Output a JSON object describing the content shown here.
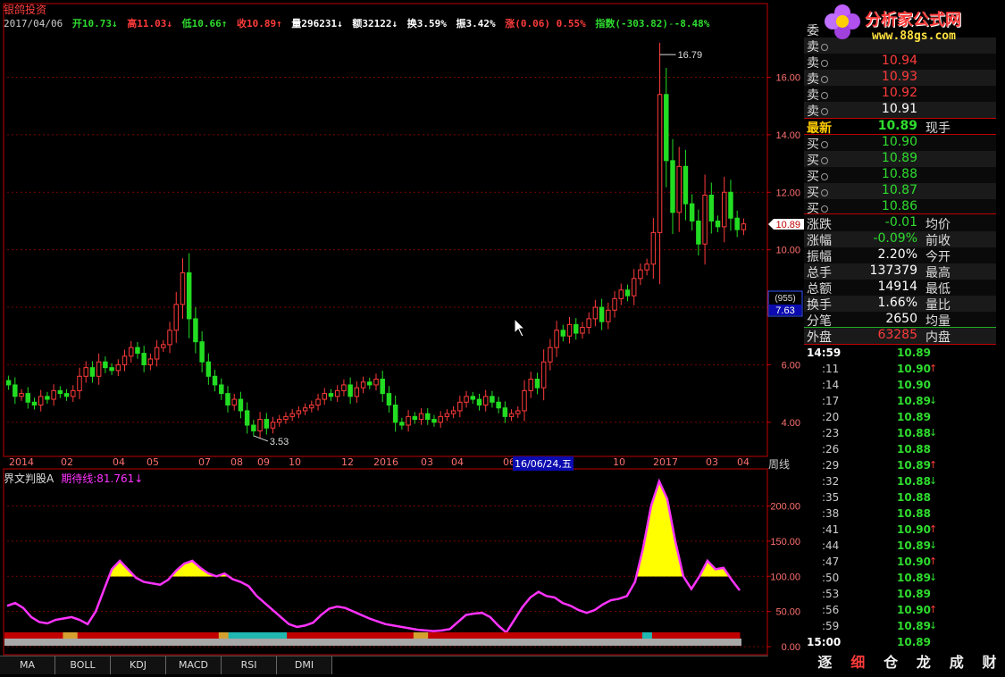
{
  "window_title": "银鸽投资",
  "quote_bar": {
    "date": "2017/04/06",
    "open_label": "开",
    "open": "10.73",
    "open_arrow": "↓",
    "high_label": "高",
    "high": "11.03",
    "high_arrow": "↓",
    "low_label": "低",
    "low": "10.66",
    "low_arrow": "↑",
    "close_label": "收",
    "close": "10.89",
    "close_arrow": "↑",
    "volume_label": "量",
    "volume": "296231",
    "volume_arrow": "↓",
    "amount_label": "额",
    "amount": "32122",
    "amount_arrow": "↓",
    "turnover_label": "换",
    "turnover": "3.59%",
    "amplitude_label": "振",
    "amplitude": "3.42%",
    "change_label": "涨",
    "change": "(0.06)",
    "change_pct": "0.55%",
    "index_label": "指数",
    "index_change": "(-303.82)",
    "index_pct": "-8.48%"
  },
  "colors": {
    "up": "#ff3b3b",
    "down": "#22dd22",
    "grid": "#7a0000",
    "indicator_line": "#ff33ff",
    "fill": "#ffff00",
    "axis_text": "#ff7070"
  },
  "chart_data": [
    {
      "type": "candlestick",
      "title": "",
      "period_label": "周线",
      "ylim": [
        3.0,
        17.6
      ],
      "y_ticks": [
        "4.00",
        "6.00",
        "8.00",
        "10.00",
        "12.00",
        "14.00",
        "16.00"
      ],
      "x_tick_labels": [
        "2014",
        "02",
        "04",
        "05",
        "07",
        "08",
        "09",
        "10",
        "12",
        "2016",
        "03",
        "04",
        "06",
        "10",
        "2017",
        "03",
        "04"
      ],
      "crosshair_date": "16/06/24,五",
      "annotations": {
        "max": "16.79",
        "min": "3.53",
        "current_price": "10.89",
        "cursor_count": "(955)",
        "cursor_price": "7.63"
      },
      "close": [
        5.3,
        4.9,
        5.0,
        4.7,
        4.6,
        4.9,
        4.8,
        5.1,
        5.0,
        4.9,
        5.1,
        5.6,
        5.9,
        5.6,
        6.1,
        5.9,
        5.8,
        6.0,
        6.3,
        6.6,
        6.4,
        6.0,
        6.2,
        6.6,
        6.7,
        7.2,
        8.1,
        9.2,
        7.6,
        6.8,
        6.1,
        5.6,
        5.3,
        5.0,
        4.6,
        4.8,
        4.4,
        3.9,
        3.7,
        4.1,
        3.8,
        4.0,
        4.1,
        4.2,
        4.3,
        4.4,
        4.5,
        4.6,
        4.8,
        5.0,
        4.9,
        5.1,
        5.3,
        4.9,
        5.2,
        5.4,
        5.3,
        5.5,
        5.0,
        4.6,
        4.0,
        3.9,
        4.2,
        4.1,
        4.3,
        4.1,
        4.0,
        4.2,
        4.3,
        4.4,
        4.7,
        4.9,
        4.8,
        4.6,
        4.9,
        4.7,
        4.5,
        4.2,
        4.3,
        4.4,
        5.1,
        5.5,
        5.2,
        6.1,
        6.6,
        7.2,
        7.0,
        7.4,
        7.1,
        7.3,
        7.6,
        8.0,
        7.5,
        7.9,
        8.3,
        8.6,
        8.4,
        9.0,
        9.3,
        9.5,
        10.6,
        15.4,
        13.1,
        11.3,
        12.9,
        11.6,
        11.0,
        10.2,
        11.9,
        11.0,
        10.8,
        12.0,
        11.1,
        10.7,
        10.9
      ]
    },
    {
      "type": "line",
      "title": "界文判股A",
      "series_name": "期待线",
      "current_value": "81.761",
      "current_arrow": "↓",
      "ylim": [
        0,
        240
      ],
      "y_ticks": [
        "0.00",
        "50.00",
        "100.00",
        "150.00",
        "200.00"
      ],
      "threshold": 100,
      "values": [
        58,
        62,
        55,
        42,
        35,
        33,
        38,
        40,
        42,
        38,
        32,
        50,
        80,
        110,
        122,
        110,
        98,
        92,
        90,
        88,
        95,
        108,
        118,
        122,
        112,
        104,
        100,
        104,
        96,
        92,
        86,
        72,
        62,
        52,
        42,
        32,
        28,
        30,
        34,
        45,
        54,
        57,
        55,
        50,
        45,
        40,
        36,
        32,
        30,
        28,
        26,
        24,
        23,
        22,
        23,
        25,
        35,
        45,
        47,
        48,
        42,
        30,
        20,
        38,
        56,
        70,
        78,
        72,
        70,
        62,
        58,
        52,
        48,
        52,
        60,
        66,
        68,
        72,
        92,
        140,
        200,
        235,
        210,
        150,
        100,
        82,
        100,
        122,
        110,
        112,
        95,
        80
      ],
      "band_colors": [
        "#c00000",
        "#c00000",
        "#c00000",
        "#c00000",
        "#c00000",
        "#c00000",
        "#c00000",
        "#c00000",
        "#c00000",
        "#c00000",
        "#c00000",
        "#c00000",
        "#d4a030",
        "#d4a030",
        "#d4a030",
        "#c00000",
        "#c00000",
        "#c00000",
        "#c00000",
        "#c00000",
        "#c00000",
        "#c00000",
        "#c00000",
        "#c00000",
        "#c00000",
        "#c00000",
        "#c00000",
        "#c00000",
        "#c00000",
        "#c00000",
        "#c00000",
        "#c00000",
        "#c00000",
        "#c00000",
        "#c00000",
        "#c00000",
        "#c00000",
        "#c00000",
        "#c00000",
        "#c00000",
        "#c00000",
        "#c00000",
        "#c00000",
        "#c00000",
        "#d4a030",
        "#d4a030",
        "#20b8b0",
        "#20b8b0",
        "#20b8b0",
        "#20b8b0",
        "#20b8b0",
        "#20b8b0",
        "#20b8b0",
        "#20b8b0",
        "#20b8b0",
        "#20b8b0",
        "#20b8b0",
        "#20b8b0",
        "#c00000",
        "#c00000",
        "#c00000",
        "#c00000",
        "#c00000",
        "#c00000",
        "#c00000",
        "#c00000",
        "#c00000",
        "#c00000",
        "#c00000",
        "#c00000",
        "#c00000",
        "#c00000",
        "#c00000",
        "#c00000",
        "#c00000",
        "#c00000",
        "#c00000",
        "#c00000",
        "#c00000",
        "#c00000",
        "#c00000",
        "#c00000",
        "#c00000",
        "#c00000",
        "#d4a030",
        "#d4a030",
        "#d4a030",
        "#c00000",
        "#c00000",
        "#c00000",
        "#c00000",
        "#c00000",
        "#c00000",
        "#c00000",
        "#c00000",
        "#c00000",
        "#c00000",
        "#c00000",
        "#c00000",
        "#c00000",
        "#c00000",
        "#c00000",
        "#c00000",
        "#c00000",
        "#c00000",
        "#c00000",
        "#c00000",
        "#c00000",
        "#c00000",
        "#c00000",
        "#c00000",
        "#c00000",
        "#c00000",
        "#c00000",
        "#c00000",
        "#c00000",
        "#c00000",
        "#c00000",
        "#c00000",
        "#c00000",
        "#c00000",
        "#c00000",
        "#c00000",
        "#c00000",
        "#c00000",
        "#c00000",
        "#c00000",
        "#c00000",
        "#c00000",
        "#c00000",
        "#c00000",
        "#20b8b0",
        "#20b8b0",
        "#c00000",
        "#c00000",
        "#c00000",
        "#c00000",
        "#c00000",
        "#c00000",
        "#c00000",
        "#c00000",
        "#c00000",
        "#c00000",
        "#c00000",
        "#c00000",
        "#c00000",
        "#c00000",
        "#c00000",
        "#c00000",
        "#c00000",
        "#c00000"
      ]
    }
  ],
  "indicator_tabs": [
    "MA",
    "BOLL",
    "KDJ",
    "MACD",
    "RSI",
    "DMI"
  ],
  "logo": {
    "text": "分析家公式网",
    "url": "www.88gs.com"
  },
  "order_book": {
    "ask_header": "委",
    "asks": [
      {
        "label": "卖",
        "n": "5",
        "price": "",
        "color": "#ff3b3b"
      },
      {
        "label": "卖",
        "n": "4",
        "price": "10.94",
        "color": "#ff3b3b"
      },
      {
        "label": "卖",
        "n": "3",
        "price": "10.93",
        "color": "#ff3b3b"
      },
      {
        "label": "卖",
        "n": "2",
        "price": "10.92",
        "color": "#ff3b3b"
      },
      {
        "label": "卖",
        "n": "1",
        "price": "10.91",
        "color": "#ffffff"
      }
    ],
    "latest_label": "最新",
    "latest_price": "10.89",
    "latest_extra": "现手",
    "bids": [
      {
        "label": "买",
        "n": "1",
        "price": "10.90",
        "color": "#2fdc2f"
      },
      {
        "label": "买",
        "n": "2",
        "price": "10.89",
        "color": "#2fdc2f"
      },
      {
        "label": "买",
        "n": "3",
        "price": "10.88",
        "color": "#2fdc2f"
      },
      {
        "label": "买",
        "n": "4",
        "price": "10.87",
        "color": "#2fdc2f"
      },
      {
        "label": "买",
        "n": "5",
        "price": "10.86",
        "color": "#2fdc2f"
      }
    ]
  },
  "stats": [
    {
      "label": "涨跌",
      "value": "-0.01",
      "label2": "均价",
      "color": "#2fdc2f"
    },
    {
      "label": "涨幅",
      "value": "-0.09%",
      "label2": "前收",
      "color": "#2fdc2f"
    },
    {
      "label": "振幅",
      "value": "2.20%",
      "label2": "今开",
      "color": "#ffffff"
    },
    {
      "label": "总手",
      "value": "137379",
      "label2": "最高",
      "color": "#ffffff"
    },
    {
      "label": "总额",
      "value": "14914",
      "label2": "最低",
      "color": "#ffffff"
    },
    {
      "label": "换手",
      "value": "1.66%",
      "label2": "量比",
      "color": "#ffffff"
    },
    {
      "label": "分笔",
      "value": "2650",
      "label2": "均量",
      "color": "#ffffff"
    },
    {
      "label": "外盘",
      "value": "63285",
      "label2": "内盘",
      "color": "#ff3b3b"
    }
  ],
  "ticks": [
    {
      "time": "14:59",
      "price": "10.89",
      "arrow": ""
    },
    {
      "time": ":11",
      "price": "10.90",
      "arrow": "↑"
    },
    {
      "time": ":14",
      "price": "10.90",
      "arrow": ""
    },
    {
      "time": ":17",
      "price": "10.89",
      "arrow": "↓"
    },
    {
      "time": ":20",
      "price": "10.89",
      "arrow": ""
    },
    {
      "time": ":23",
      "price": "10.88",
      "arrow": "↓"
    },
    {
      "time": ":26",
      "price": "10.88",
      "arrow": ""
    },
    {
      "time": ":29",
      "price": "10.89",
      "arrow": "↑"
    },
    {
      "time": ":32",
      "price": "10.88",
      "arrow": "↓"
    },
    {
      "time": ":35",
      "price": "10.88",
      "arrow": ""
    },
    {
      "time": ":38",
      "price": "10.88",
      "arrow": ""
    },
    {
      "time": ":41",
      "price": "10.90",
      "arrow": "↑"
    },
    {
      "time": ":44",
      "price": "10.89",
      "arrow": "↓"
    },
    {
      "time": ":47",
      "price": "10.90",
      "arrow": "↑"
    },
    {
      "time": ":50",
      "price": "10.89",
      "arrow": "↓"
    },
    {
      "time": ":53",
      "price": "10.89",
      "arrow": ""
    },
    {
      "time": ":56",
      "price": "10.90",
      "arrow": "↑"
    },
    {
      "time": ":59",
      "price": "10.89",
      "arrow": "↓"
    },
    {
      "time": "15:00",
      "price": "10.89",
      "arrow": ""
    }
  ],
  "bottom_tabs": [
    "逐",
    "细",
    "仓",
    "龙",
    "成",
    "财"
  ]
}
